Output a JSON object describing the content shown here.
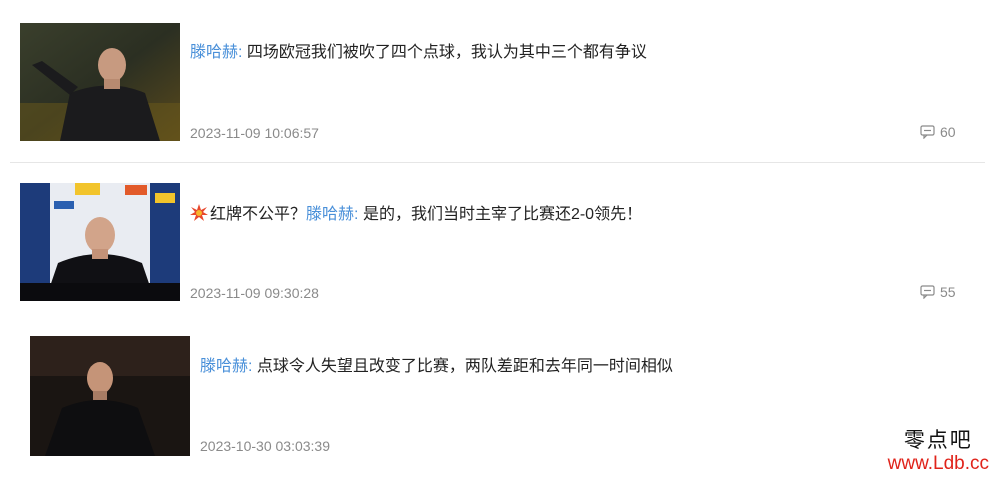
{
  "items": [
    {
      "speaker": "滕哈赫",
      "sep": ":",
      "prefix": "",
      "title": "四场欧冠我们被吹了四个点球，我认为其中三个都有争议",
      "time": "2023-11-09 10:06:57",
      "comments": "60",
      "comment_icon": "comment-bubble-icon"
    },
    {
      "speaker": "滕哈赫",
      "sep": ":",
      "prefix": "红牌不公平？",
      "prefix_icon": "collision-icon",
      "title": "是的，我们当时主宰了比赛还2-0领先！",
      "time": "2023-11-09 09:30:28",
      "comments": "55",
      "comment_icon": "comment-bubble-icon"
    },
    {
      "speaker": "滕哈赫",
      "sep": ":",
      "prefix": "",
      "title": "点球令人失望且改变了比赛，两队差距和去年同一时间相似",
      "time": "2023-10-30 03:03:39"
    }
  ],
  "watermark": {
    "cn": "零点吧",
    "url": "www.Ldb.cc"
  },
  "colors": {
    "speaker": "#4a90d9",
    "meta": "#8a8a8a",
    "watermark_url": "#e0231a"
  }
}
